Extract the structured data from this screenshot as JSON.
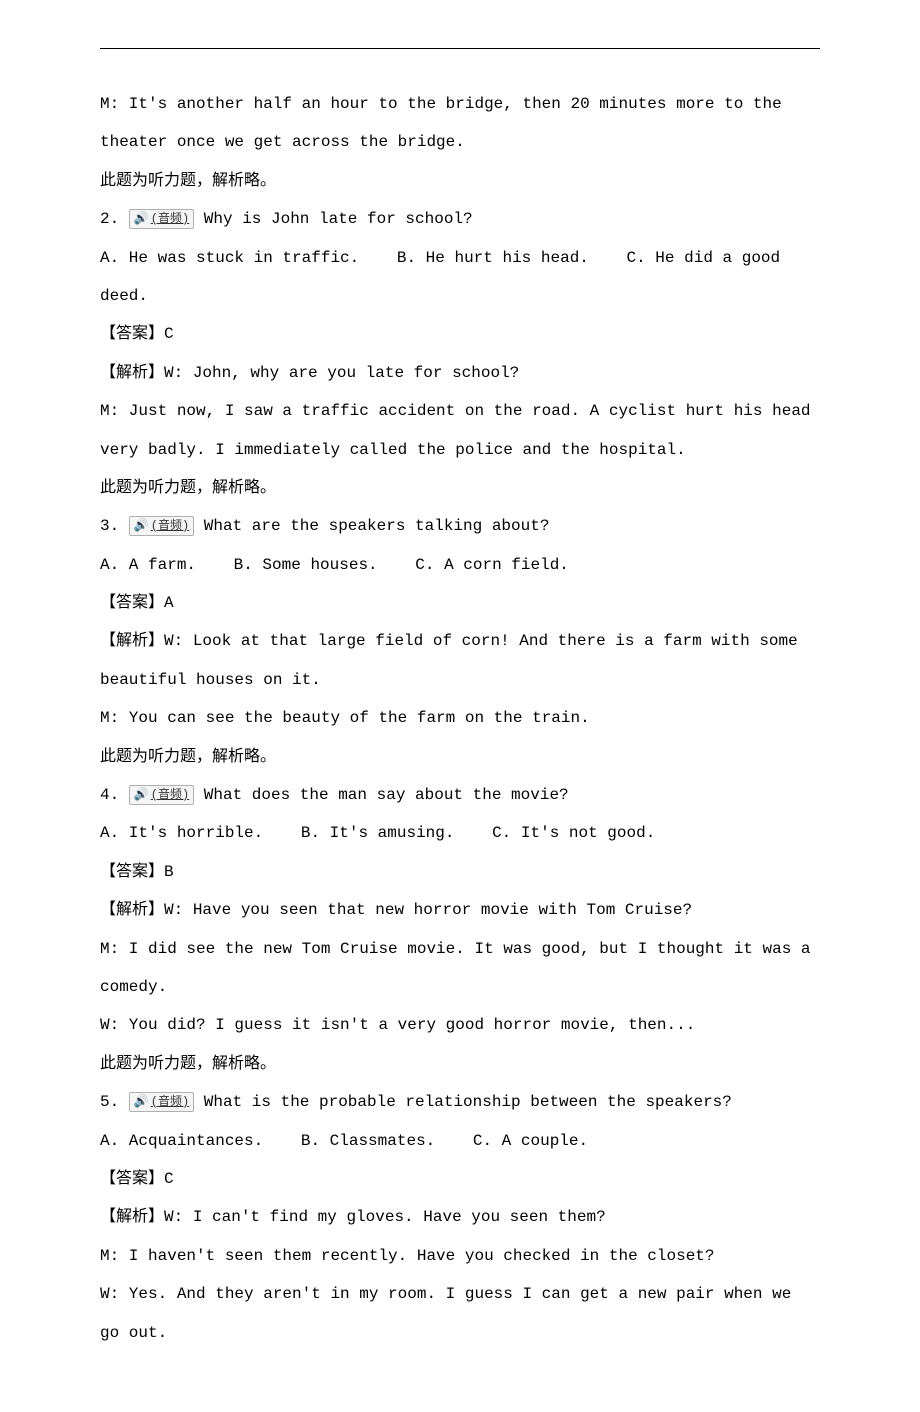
{
  "audio_label": "(音频)",
  "answer_label": "【答案】",
  "explain_label": "【解析】",
  "listening_note": "此题为听力题，解析略。",
  "intro_m": "M: It's another half an hour to the bridge, then 20 minutes more to the theater once we get across the bridge.",
  "q2": {
    "num": "2.",
    "question": "Why is John late for school?",
    "optA": "A. He was stuck in traffic.",
    "optB": "B. He hurt his head.",
    "optC": "C. He did a good deed.",
    "answer": "C",
    "w": "W: John, why are you late for school?",
    "m": "M: Just now, I saw a traffic accident on the road. A cyclist hurt his head very badly. I immediately called the police and the hospital."
  },
  "q3": {
    "num": "3.",
    "question": "What are the speakers talking about?",
    "optA": "A. A farm.",
    "optB": "B. Some houses.",
    "optC": "C. A corn field.",
    "answer": "A",
    "w": "W: Look at that large field of corn! And there is a farm with some beautiful houses on it.",
    "m": "M: You can see the beauty of the farm on the train."
  },
  "q4": {
    "num": "4.",
    "question": "What does the man say about the movie?",
    "optA": "A. It's horrible.",
    "optB": "B. It's amusing.",
    "optC": "C. It's not good.",
    "answer": "B",
    "w1": "W: Have you seen that new horror movie with Tom Cruise?",
    "m": "M: I did see the new Tom Cruise movie. It was good, but I thought it was a comedy.",
    "w2": "W: You did? I guess it isn't a very good horror movie, then..."
  },
  "q5": {
    "num": "5.",
    "question": "What is the probable relationship between the speakers?",
    "optA": "A. Acquaintances.",
    "optB": "B. Classmates.",
    "optC": "C. A couple.",
    "answer": "C",
    "w1": "W: I can't find my gloves. Have you seen them?",
    "m": "M: I haven't seen them recently. Have you checked in the closet?",
    "w2": "W: Yes. And they aren't in my room. I guess I can get a new pair when we go out."
  }
}
